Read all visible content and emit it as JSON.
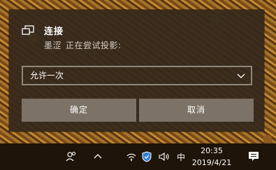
{
  "notification": {
    "title": "连接",
    "device_name": "墨涩",
    "message": "正在尝试投影:",
    "select_value": "允许一次",
    "ok_label": "确定",
    "cancel_label": "取消"
  },
  "taskbar": {
    "ime": "中",
    "time": "20:35",
    "date": "2019/4/21"
  },
  "colors": {
    "panel_bg": "#34281c",
    "button_bg": "#7d7266",
    "taskbar_bg": "#1f140a",
    "defender_blue": "#2f7fd6"
  },
  "icons": [
    "project-icon",
    "chevron-down-icon",
    "people-icon",
    "chevron-up-icon",
    "wifi-icon",
    "shield-icon",
    "volume-icon",
    "action-center-icon"
  ]
}
